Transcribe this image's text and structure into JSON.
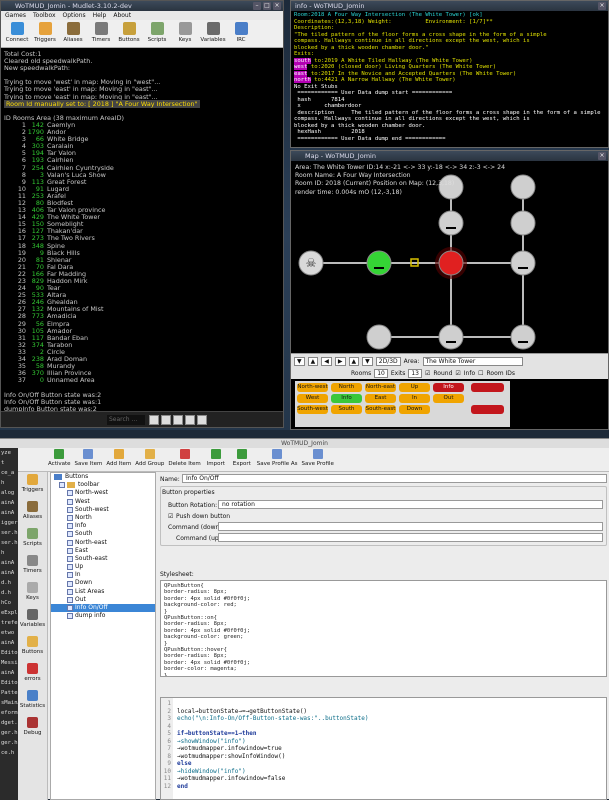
{
  "mudlet": {
    "title": "WoTMUD_Jomin - Mudlet-3.10.2-dev",
    "menu": [
      "Games",
      "Toolbox",
      "Options",
      "Help",
      "About"
    ],
    "toolbar": [
      {
        "label": "Connect",
        "icon": "connect-icon",
        "color": "#3a8ed8"
      },
      {
        "label": "Triggers",
        "icon": "triggers-icon",
        "color": "#e6a23c"
      },
      {
        "label": "Aliases",
        "icon": "aliases-icon",
        "color": "#8b6d3c"
      },
      {
        "label": "Timers",
        "icon": "timers-icon",
        "color": "#7a7a7a"
      },
      {
        "label": "Buttons",
        "icon": "buttons-icon",
        "color": "#c7a03c"
      },
      {
        "label": "Scripts",
        "icon": "scripts-icon",
        "color": "#7da56b"
      },
      {
        "label": "Keys",
        "icon": "keys-icon",
        "color": "#999"
      },
      {
        "label": "Variables",
        "icon": "variables-icon",
        "color": "#6b6b6b"
      },
      {
        "label": "IRC",
        "icon": "irc-icon",
        "color": "#4a7ec8"
      }
    ],
    "console_top": [
      "Total Cost:1",
      "Cleared old speedwalkPath.",
      "New speedwalkPath:",
      "",
      "Trying to move 'west' in map: Moving in \"west\"...",
      "Trying to move 'east' in map: Moving in \"east\"...",
      "Trying to move 'east' in map: Moving in \"east\"..."
    ],
    "room_banner": " Room Id manually set to: [ 2018 ] \"A Four Way Intersection\" ",
    "rooms_header": "ID Rooms Area (38 maximum AreaID)",
    "rooms": [
      [
        "1",
        "142",
        "Caemlyn"
      ],
      [
        "2",
        "1790",
        "Andor"
      ],
      [
        "3",
        "66",
        "White Bridge"
      ],
      [
        "4",
        "303",
        "Caralain"
      ],
      [
        "5",
        "194",
        "Tar Valon"
      ],
      [
        "6",
        "193",
        "Cairhien"
      ],
      [
        "7",
        "254",
        "Cairhien Cyuntryside"
      ],
      [
        "8",
        "3",
        "Valan's Luca Show"
      ],
      [
        "9",
        "113",
        "Great Forest"
      ],
      [
        "10",
        "91",
        "Lugard"
      ],
      [
        "11",
        "253",
        "Arafel"
      ],
      [
        "12",
        "80",
        "Blodfest"
      ],
      [
        "13",
        "406",
        "Tar Valon province"
      ],
      [
        "14",
        "429",
        "The White Tower"
      ],
      [
        "15",
        "150",
        "Someblight"
      ],
      [
        "16",
        "127",
        "Thakan'dar"
      ],
      [
        "17",
        "273",
        "The Two Rivers"
      ],
      [
        "18",
        "348",
        "Spine"
      ],
      [
        "19",
        "9",
        "Black Hills"
      ],
      [
        "20",
        "81",
        "Shienar"
      ],
      [
        "21",
        "70",
        "Fal Dara"
      ],
      [
        "22",
        "166",
        "Far Madding"
      ],
      [
        "23",
        "829",
        "Haddon Mirk"
      ],
      [
        "24",
        "90",
        "Tear"
      ],
      [
        "25",
        "533",
        "Altara"
      ],
      [
        "26",
        "246",
        "Ghealdan"
      ],
      [
        "27",
        "132",
        "Mountains of Mist"
      ],
      [
        "28",
        "773",
        "Amadicia"
      ],
      [
        "29",
        "56",
        "Elmpra"
      ],
      [
        "30",
        "105",
        "Amador"
      ],
      [
        "31",
        "117",
        "Bandar Eban"
      ],
      [
        "32",
        "374",
        "Tarabon"
      ],
      [
        "33",
        "2",
        "Circle"
      ],
      [
        "34",
        "238",
        "Arad Doman"
      ],
      [
        "35",
        "58",
        "Murandy"
      ],
      [
        "36",
        "370",
        "Illian Province"
      ],
      [
        "37",
        "0",
        "Unnamed Area"
      ]
    ],
    "console_bottom": [
      "Info On/Off Button state was:2",
      "Info On/Off Button state was:1",
      "dumpInfo Button state was:2",
      "dumpInfo Button state was:1",
      "Info On/Off Button state was:2",
      "Info On/Off Button state was:1"
    ],
    "search_placeholder": "Search ..."
  },
  "info": {
    "title": "info - WoTMUD_Jomin",
    "lines": [
      {
        "t": "Room:2018 A Four Way Intersection (The White Tower) [ok]",
        "c": "cyan"
      },
      {
        "t": "Coordinates:(12,3,18) Weight:          Environment: [1/7]**",
        "c": "yel"
      },
      {
        "t": "Description:",
        "c": "yel"
      },
      {
        "t": "\"The tiled pattern of the floor forms a cross shape in the form of a simple",
        "c": "yel"
      },
      {
        "t": "compass. Hallways continue in all directions except the west, which is",
        "c": "yel"
      },
      {
        "t": "blocked by a thick wooden chamber door.\"",
        "c": "yel"
      },
      {
        "t": "Exits:",
        "c": "yel"
      },
      {
        "t": "south to:2019 A White Tiled Hallway (The White Tower)",
        "c": "mix",
        "k": "south"
      },
      {
        "t": "west to:2020 (closed door) Living Quarters (The White Tower)",
        "c": "mix",
        "k": "west"
      },
      {
        "t": "east to:2017 In the Novice and Accepted Quarters (The White Tower)",
        "c": "mix",
        "k": "east"
      },
      {
        "t": "north to:4421 A Narrow Hallway (The White Tower)",
        "c": "mix",
        "k": "north"
      },
      {
        "t": "No Exit Stubs",
        "c": "wh"
      },
      {
        "t": " ============ User Data dump start ============",
        "c": "wh"
      },
      {
        "t": " hash      7814",
        "c": "wh"
      },
      {
        "t": " x       chamberdoor",
        "c": "wh"
      },
      {
        "t": " description     The tiled pattern of the floor forms a cross shape in the form of a simple",
        "c": "wh"
      },
      {
        "t": "compass. Hallways continue in all directions except the west, which is",
        "c": "wh"
      },
      {
        "t": "blocked by a thick wooden chamber door.",
        "c": "wh"
      },
      {
        "t": " hexHash         2018",
        "c": "wh"
      },
      {
        "t": " ============ User Data dump end ============",
        "c": "wh"
      }
    ]
  },
  "map": {
    "title": "Map - WoTMUD_Jomin",
    "hud": [
      "Area: The White Tower ID:14 x:-21 <-> 33 y:-18 <-> 34 z:-3 <-> 24",
      "Room Name: A Four Way Intersection",
      "Room ID: 2018 (Current) Position on Map: (12,3,18)",
      "render time: 0.004s mO (12,-3,18)"
    ],
    "mode_btn": "2D/3D",
    "area_label": "Area:",
    "area_value": "The White Tower",
    "rooms_label": "Rooms",
    "rooms_value": "10",
    "exits_label": "Exits",
    "exits_value": "13",
    "round_label": "Round",
    "info_label": "Info",
    "roomids_label": "Room IDs",
    "nodes": [
      {
        "kind": "grey",
        "sym": ""
      },
      {
        "kind": "grey",
        "sym": ""
      },
      {
        "kind": "dark",
        "sym": "skull"
      },
      {
        "kind": "green",
        "sym": "dash"
      },
      {
        "kind": "red",
        "sym": ""
      },
      {
        "kind": "grey",
        "sym": "dash"
      },
      {
        "kind": "grey",
        "sym": ""
      },
      {
        "kind": "grey",
        "sym": ""
      },
      {
        "kind": "grey",
        "sym": "dash"
      },
      {
        "kind": "grey",
        "sym": "dash"
      },
      {
        "kind": "grey",
        "sym": "dash"
      }
    ],
    "dirpad": [
      {
        "label": "North-west",
        "color": "#f0a400"
      },
      {
        "label": "North",
        "color": "#f0a400"
      },
      {
        "label": "North-east",
        "color": "#f0a400"
      },
      {
        "label": "Up",
        "color": "#f0a400"
      },
      {
        "label": "Info",
        "color": "#c3161c"
      },
      {
        "label": "",
        "color": "#c3161c"
      },
      {
        "label": "West",
        "color": "#f0a400"
      },
      {
        "label": "Info",
        "color": "#3ac73a"
      },
      {
        "label": "East",
        "color": "#f0a400"
      },
      {
        "label": "In",
        "color": "#f0a400"
      },
      {
        "label": "Out",
        "color": "#f0a400"
      },
      {
        "label": "South-west",
        "color": "#f0a400"
      },
      {
        "label": "South",
        "color": "#f0a400"
      },
      {
        "label": "South-east",
        "color": "#f0a400"
      },
      {
        "label": "Down",
        "color": "#f0a400"
      },
      {
        "label": "",
        "color": "#c3161c"
      }
    ]
  },
  "editor": {
    "title": "WoTMUD_Jomin",
    "left_strip": [
      "yze",
      "t",
      "ce_a",
      "",
      "h",
      "",
      "alog",
      "ainA",
      "ainA",
      "igger",
      "ser.h",
      "ser.h",
      "h",
      "ainA",
      "ainA",
      "",
      "d.h",
      "d.h",
      "hCo",
      "eExpl",
      "trefe",
      "etwo",
      "ainA",
      "Editor",
      "Messi",
      "ainA",
      "Editor",
      "Patte",
      "sMainA",
      "eform",
      "",
      "",
      "dget.h",
      "",
      "ger.h",
      "ger.h",
      "",
      "ce.h"
    ],
    "toolbar": [
      {
        "label": "Activate",
        "color": "#3c9b3c"
      },
      {
        "label": "Save Item",
        "color": "#6a8fd0"
      },
      {
        "label": "Add Item",
        "color": "#e2a83c"
      },
      {
        "label": "Add Group",
        "color": "#e2b048"
      },
      {
        "label": "Delete Item",
        "color": "#d04040"
      },
      {
        "label": "Import",
        "color": "#3c9b3c"
      },
      {
        "label": "Export",
        "color": "#3c9b3c"
      },
      {
        "label": "Save Profile As",
        "color": "#6a8fd0"
      },
      {
        "label": "Save Profile",
        "color": "#6a8fd0"
      }
    ],
    "sidebar": [
      {
        "label": "Triggers",
        "color": "#e2a83c"
      },
      {
        "label": "Aliases",
        "color": "#8a6c3c"
      },
      {
        "label": "Scripts",
        "color": "#7da56b"
      },
      {
        "label": "Timers",
        "color": "#888"
      },
      {
        "label": "Keys",
        "color": "#aaa"
      },
      {
        "label": "Variables",
        "color": "#666"
      },
      {
        "label": "Buttons",
        "color": "#e2b048"
      },
      {
        "label": "errors",
        "color": "#c33"
      },
      {
        "label": "Statistics",
        "color": "#4a80c8"
      },
      {
        "label": "Debug",
        "color": "#a33"
      }
    ],
    "tree_root": "Buttons",
    "tree_group": "toolbar",
    "tree_items": [
      "North-west",
      "West",
      "South-west",
      "North",
      "Info",
      "South",
      "North-east",
      "East",
      "South-east",
      "Up",
      "In",
      "Down",
      "List Areas",
      "Out",
      "Info On/Off",
      "dump info"
    ],
    "tree_selected": 14,
    "name_label": "Name:",
    "name_value": "Info On/Off",
    "props_label": "Button properties",
    "rotation_label": "Button Rotation:",
    "rotation_value": "no rotation",
    "pushdown_label": "Push down button",
    "cmd_down_label": "Command (down):",
    "cmd_up_label": "Command (up):",
    "stylesheet_label": "Stylesheet:",
    "stylesheet": [
      "QPushButton{",
      "border-radius: 8px;",
      "border: 4px solid #0f0f0j;",
      "background-color: red;",
      "}",
      "QPushButton::on{",
      "border-radius: 8px;",
      "border: 4px solid #0f0f0j;",
      "background-color: green;",
      "}",
      "QPushButton::hover{",
      "border-radius: 8px;",
      "border: 4px solid #0f0f0j;",
      "border-color: magenta;",
      "}"
    ],
    "code": [
      "",
      "local→buttonState→=→getButtonState()",
      "echo(\"\\n:Info-On/Off-Button-state-was:\"..buttonState)",
      "",
      "if→buttonState==1→then",
      "→showWindow(\"info\")",
      "→wotmudmapper.infowindow=true",
      "→wotmudmapper:showInfoWindow()",
      "else",
      "→hideWindow(\"info\")",
      "→wotmudmapper.infowindow=false",
      "end"
    ]
  }
}
